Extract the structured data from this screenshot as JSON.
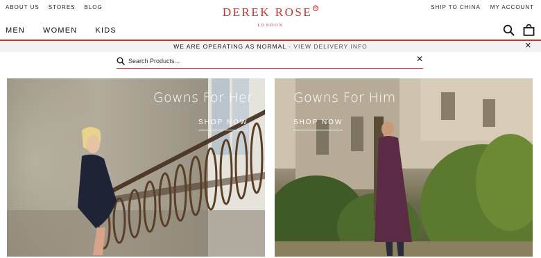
{
  "top_links_left": [
    "ABOUT US",
    "STORES",
    "BLOG"
  ],
  "top_links_right": [
    "SHIP TO CHINA",
    "MY ACCOUNT"
  ],
  "logo": {
    "name": "DEREK ROSE",
    "sub": "LONDON",
    "mark": "®"
  },
  "main_nav": [
    "MEN",
    "WOMEN",
    "KIDS"
  ],
  "icons": {
    "search": "search-icon",
    "bag": "shopping-bag-icon",
    "close": "close-icon"
  },
  "banner": {
    "text": "WE ARE OPERATING AS NORMAL",
    "separator": " - ",
    "link": "VIEW DELIVERY INFO",
    "close": "✕"
  },
  "search": {
    "placeholder": "Search Products...",
    "value": "",
    "close": "✕"
  },
  "tiles": [
    {
      "title": "Gowns For Her",
      "cta": "SHOP NOW"
    },
    {
      "title": "Gowns For Him",
      "cta": "SHOP NOW"
    }
  ],
  "colors": {
    "brand": "#c8312c",
    "banner_bg": "#f2f2f2",
    "text": "#1a1a1a"
  }
}
